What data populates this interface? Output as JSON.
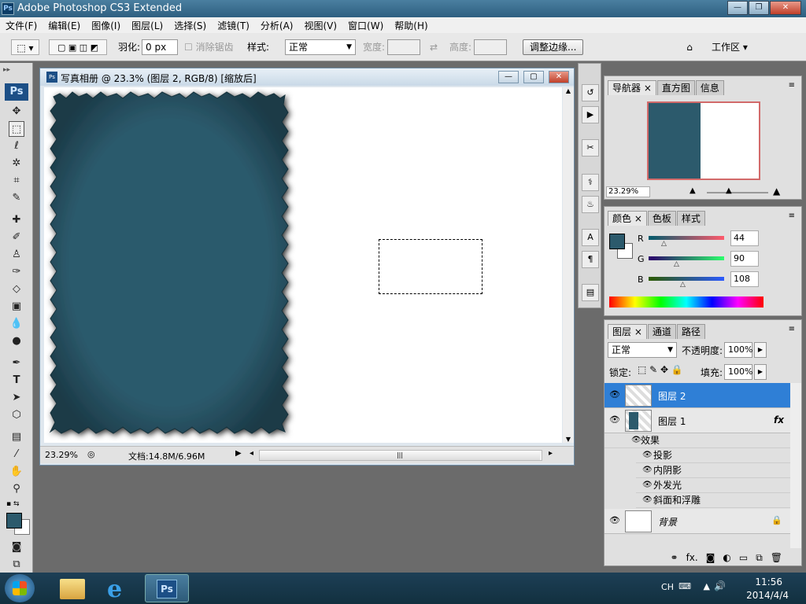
{
  "window": {
    "title": "Adobe Photoshop CS3 Extended",
    "logo": "Ps"
  },
  "menu": [
    "文件(F)",
    "编辑(E)",
    "图像(I)",
    "图层(L)",
    "选择(S)",
    "滤镜(T)",
    "分析(A)",
    "视图(V)",
    "窗口(W)",
    "帮助(H)"
  ],
  "options": {
    "feather_label": "羽化:",
    "feather_value": "0 px",
    "antialias": "消除锯齿",
    "style_label": "样式:",
    "style_value": "正常",
    "width_label": "宽度:",
    "height_label": "高度:",
    "refine_edge": "调整边缘...",
    "workspace": "工作区"
  },
  "toolbox": {
    "logo": "Ps"
  },
  "document": {
    "title": "写真相册 @ 23.3% (图层 2, RGB/8) [缩放后]",
    "zoom": "23.29%",
    "doc_info": "文档:14.8M/6.96M",
    "icon": "Ps"
  },
  "navigator": {
    "tabs": [
      "导航器",
      "直方图",
      "信息"
    ],
    "zoom": "23.29%"
  },
  "color_panel": {
    "tabs": [
      "颜色",
      "色板",
      "样式"
    ],
    "r_label": "R",
    "r": "44",
    "g_label": "G",
    "g": "90",
    "b_label": "B",
    "b": "108",
    "foreground": "#2c5a6c"
  },
  "layers_panel": {
    "tabs": [
      "图层",
      "通道",
      "路径"
    ],
    "blend_mode": "正常",
    "opacity_label": "不透明度:",
    "opacity": "100%",
    "lock_label": "锁定:",
    "fill_label": "填充:",
    "fill": "100%",
    "layers": [
      {
        "name": "图层 2",
        "selected": true
      },
      {
        "name": "图层 1",
        "fx": "fx"
      },
      {
        "name": "背景",
        "locked": true
      }
    ],
    "effects_label": "效果",
    "effects": [
      "投影",
      "内阴影",
      "外发光",
      "斜面和浮雕"
    ]
  },
  "taskbar": {
    "lang": "CH",
    "time": "11:56",
    "date": "2014/4/4",
    "ps_label": "Ps"
  },
  "colors": {
    "teal": "#2c5a6c",
    "selected": "#2f7fd6"
  }
}
